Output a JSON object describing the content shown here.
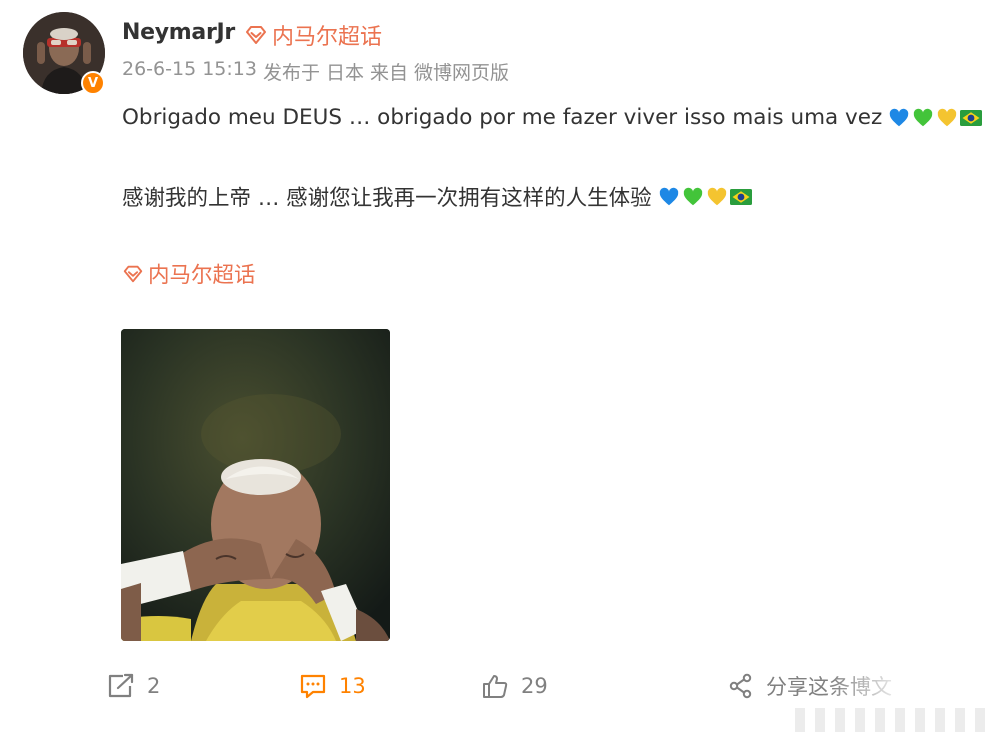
{
  "post": {
    "username": "NeymarJr",
    "supertopic_badge": "内马尔超话",
    "timestamp": "26-6-15 15:13",
    "location": "发布于 日本",
    "source": "来自 微博网页版",
    "text_line1": "Obrigado meu DEUS … obrigado por me fazer viver isso mais uma vez",
    "text_line2": "感谢我的上帝 … 感谢您让我再一次拥有这样的人生体验",
    "topic_link": "内马尔超话",
    "emojis": [
      "blue-heart",
      "green-heart",
      "yellow-heart",
      "brazil-flag"
    ]
  },
  "actions": {
    "repost_count": "2",
    "comment_count": "13",
    "like_count": "29",
    "share_label": "分享这条博文"
  },
  "colors": {
    "accent_orange": "#ff8200",
    "topic_orange": "#eb7350",
    "meta_gray": "#939393",
    "text_dark": "#333333"
  }
}
